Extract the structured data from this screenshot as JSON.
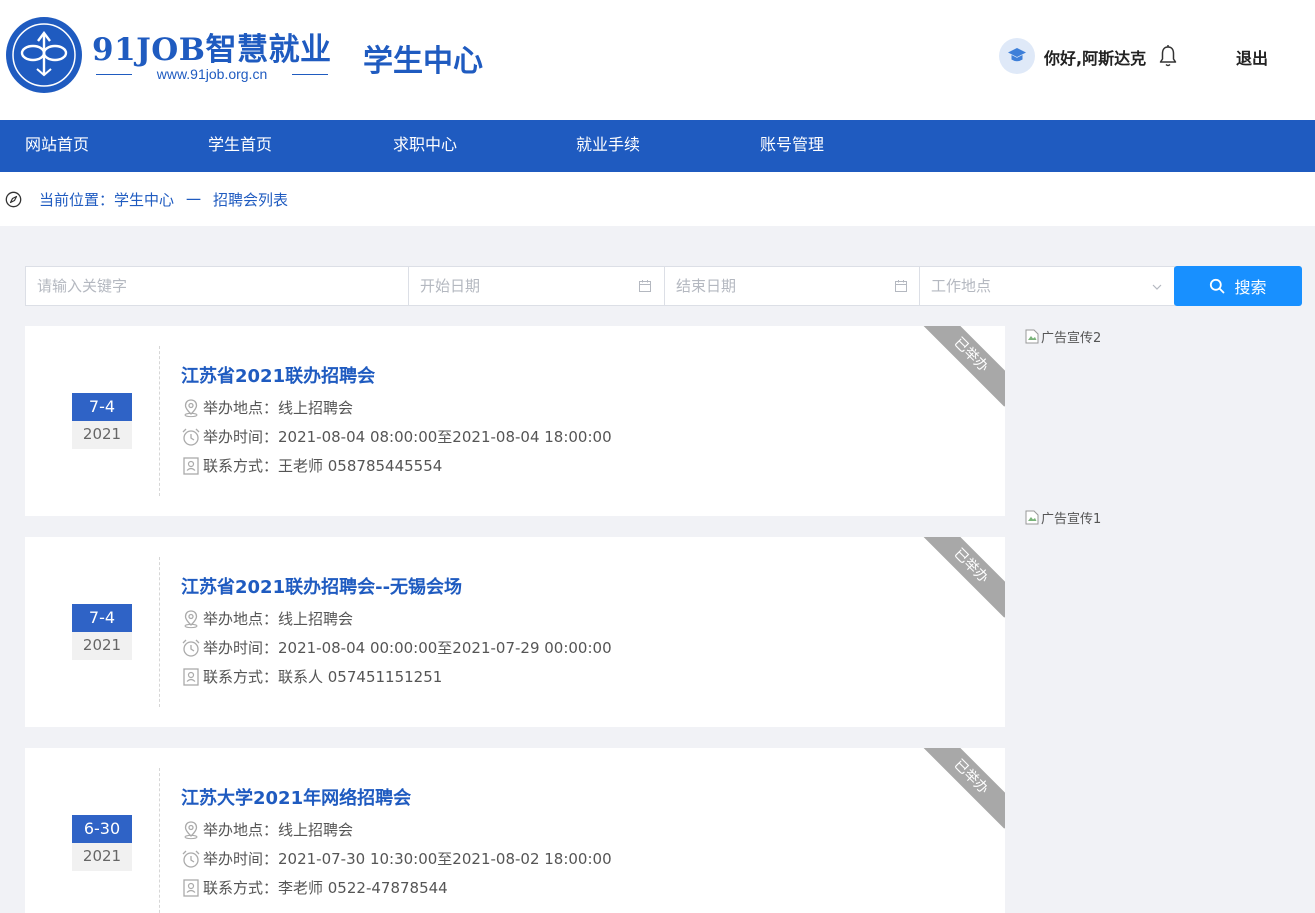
{
  "header": {
    "brand": "91JOB智慧就业",
    "url": "www.91job.org.cn",
    "center_title": "学生中心",
    "greeting": "你好,阿斯达克",
    "logout": "退出"
  },
  "nav": [
    {
      "label": "网站首页"
    },
    {
      "label": "学生首页"
    },
    {
      "label": "求职中心"
    },
    {
      "label": "就业手续"
    },
    {
      "label": "账号管理"
    }
  ],
  "breadcrumb": {
    "prefix": "当前位置：",
    "level1": "学生中心",
    "separator": "一",
    "level2": "招聘会列表"
  },
  "search": {
    "keyword_placeholder": "请输入关键字",
    "start_placeholder": "开始日期",
    "end_placeholder": "结束日期",
    "location_placeholder": "工作地点",
    "button": "搜索"
  },
  "fairs": [
    {
      "date": "7-4",
      "year": "2021",
      "title": "江苏省2021联办招聘会",
      "location": "举办地点：线上招聘会",
      "time": "举办时间：2021-08-04 08:00:00至2021-08-04 18:00:00",
      "contact": "联系方式：王老师   058785445554",
      "status": "已举办"
    },
    {
      "date": "7-4",
      "year": "2021",
      "title": "江苏省2021联办招聘会--无锡会场",
      "location": "举办地点：线上招聘会",
      "time": "举办时间：2021-08-04 00:00:00至2021-07-29 00:00:00",
      "contact": "联系方式：联系人   057451151251",
      "status": "已举办"
    },
    {
      "date": "6-30",
      "year": "2021",
      "title": "江苏大学2021年网络招聘会",
      "location": "举办地点：线上招聘会",
      "time": "举办时间：2021-07-30 10:30:00至2021-08-02 18:00:00",
      "contact": "联系方式：李老师   0522-47878544",
      "status": "已举办"
    }
  ],
  "ads": [
    {
      "alt": "广告宣传2"
    },
    {
      "alt": "广告宣传1"
    }
  ],
  "colors": {
    "brand_blue": "#1f5bc0",
    "search_blue": "#1890ff",
    "ribbon_gray": "#a8a8a8"
  }
}
